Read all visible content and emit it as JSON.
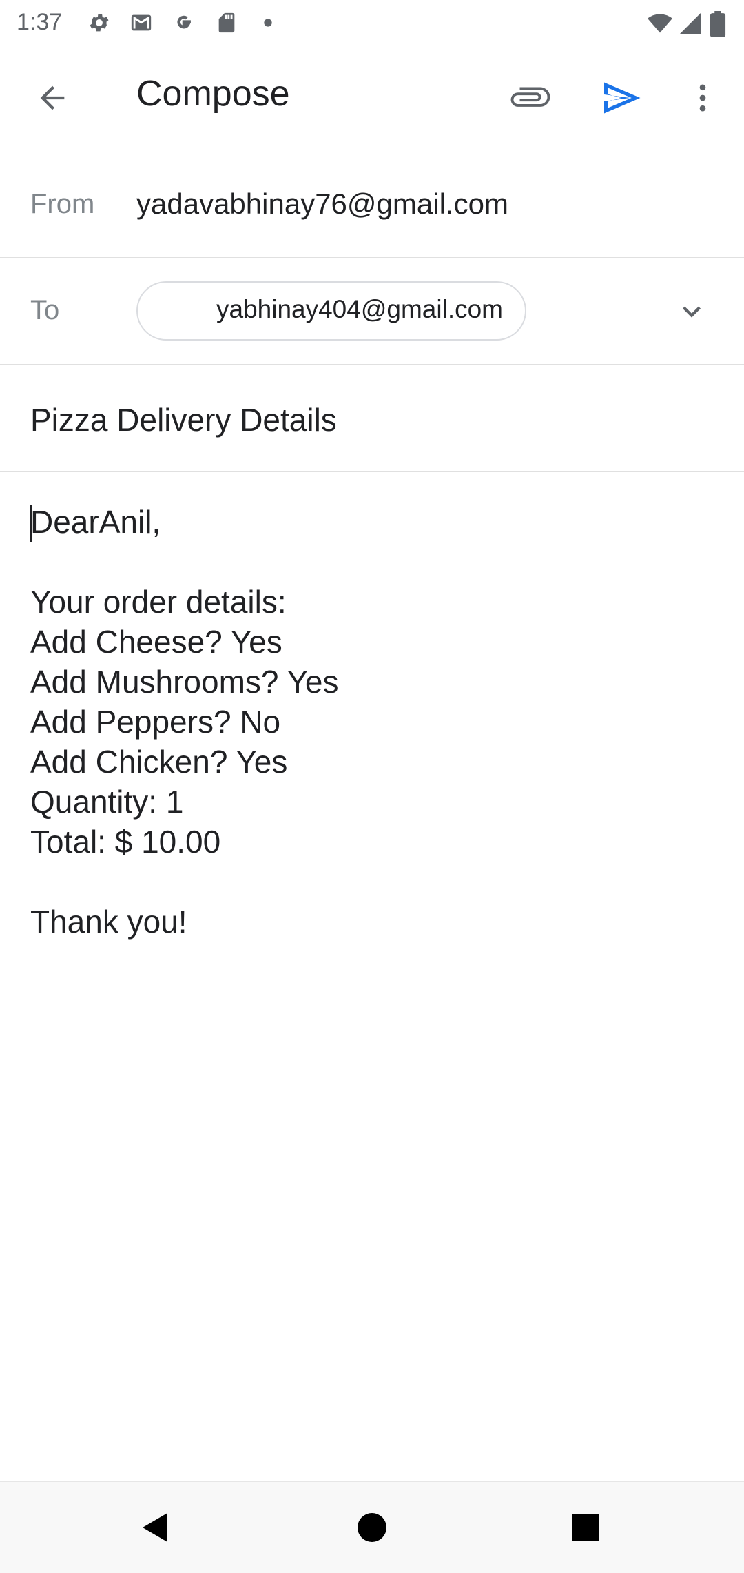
{
  "status_bar": {
    "time": "1:37",
    "icons": [
      "settings-icon",
      "gmail-icon",
      "google-icon",
      "sd-card-icon",
      "dot-icon",
      "wifi-icon",
      "signal-icon",
      "battery-icon"
    ]
  },
  "app_bar": {
    "title": "Compose",
    "back_icon": "arrow-back-icon",
    "attach_icon": "paperclip-icon",
    "send_icon": "send-icon",
    "more_icon": "more-vert-icon",
    "accent_color": "#1a73e8"
  },
  "compose": {
    "from_label": "From",
    "from_value": "yadavabhinay76@gmail.com",
    "to_label": "To",
    "to_chip": "yabhinay404@gmail.com",
    "subject": "Pizza Delivery Details",
    "body": "DearAnil,\n\nYour order details:\nAdd Cheese? Yes\nAdd Mushrooms? Yes\nAdd Peppers? No\nAdd Chicken? Yes\nQuantity: 1\nTotal: $ 10.00\n\nThank you!"
  },
  "nav_bar": {
    "back": "nav-back-icon",
    "home": "nav-home-icon",
    "recents": "nav-recents-icon"
  }
}
